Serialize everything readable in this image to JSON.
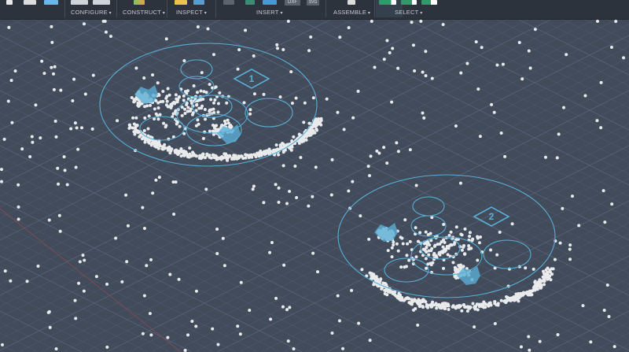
{
  "toolbar": {
    "groups": [
      {
        "label": "CONFIGURE"
      },
      {
        "label": "CONSTRUCT"
      },
      {
        "label": "INSPECT"
      },
      {
        "label": "INSERT"
      },
      {
        "label": "ASSEMBLE"
      },
      {
        "label": "SELECT"
      }
    ],
    "insert_dxf": "DXF",
    "insert_svg": "SVG"
  },
  "viewport": {
    "sketch_labels": [
      "1",
      "2"
    ],
    "colors": {
      "background": "#414b5a",
      "grid": "#56627a",
      "sketch": "#5aaed6",
      "points": "#e8eaec"
    }
  }
}
